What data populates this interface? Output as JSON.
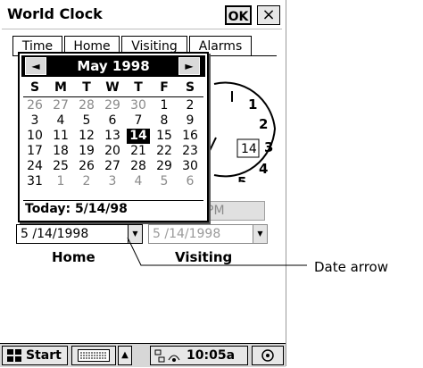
{
  "window": {
    "title": "World Clock",
    "ok_label": "OK",
    "close_label": "×"
  },
  "tabs": [
    {
      "label": "Time"
    },
    {
      "label": "Home"
    },
    {
      "label": "Visiting"
    },
    {
      "label": "Alarms"
    }
  ],
  "clock": {
    "numbers": [
      "1",
      "2",
      "3",
      "4",
      "5"
    ],
    "date_badge": "14"
  },
  "calendar": {
    "month_label": "May 1998",
    "prev_icon": "◄",
    "next_icon": "►",
    "weekdays": [
      "S",
      "M",
      "T",
      "W",
      "T",
      "F",
      "S"
    ],
    "weeks": [
      [
        "26",
        "27",
        "28",
        "29",
        "30",
        "1",
        "2"
      ],
      [
        "3",
        "4",
        "5",
        "6",
        "7",
        "8",
        "9"
      ],
      [
        "10",
        "11",
        "12",
        "13",
        "14",
        "15",
        "16"
      ],
      [
        "17",
        "18",
        "19",
        "20",
        "21",
        "22",
        "23"
      ],
      [
        "24",
        "25",
        "26",
        "27",
        "28",
        "29",
        "30"
      ],
      [
        "31",
        "1",
        "2",
        "3",
        "4",
        "5",
        "6"
      ]
    ],
    "dimmed_cells": [
      "0-0",
      "0-1",
      "0-2",
      "0-3",
      "0-4",
      "5-1",
      "5-2",
      "5-3",
      "5-4",
      "5-5",
      "5-6"
    ],
    "selected_cell": "2-4",
    "today_label": "Today: 5/14/98"
  },
  "time_field": {
    "partial_text": "PM"
  },
  "home": {
    "date_value": "5 /14/1998",
    "label": "Home"
  },
  "visiting": {
    "date_value": "5 /14/1998",
    "label": "Visiting"
  },
  "taskbar": {
    "start_label": "Start",
    "clock": "10:05a"
  },
  "annotation": {
    "text": "Date arrow"
  }
}
